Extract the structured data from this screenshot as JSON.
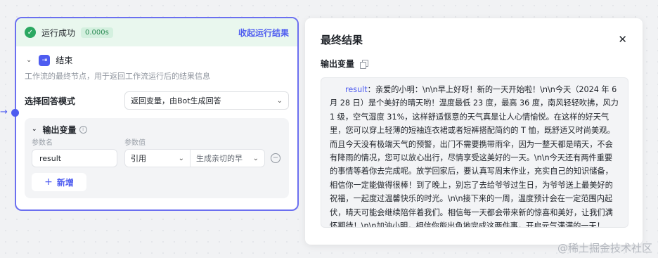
{
  "run_bar": {
    "status": "运行成功",
    "duration": "0.000s",
    "collapse_label": "收起运行结果"
  },
  "node": {
    "title": "结束",
    "description": "工作流的最终节点，用于返回工作流运行后的结果信息",
    "mode_label": "选择回答模式",
    "mode_value": "返回变量，由Bot生成回答"
  },
  "output": {
    "title": "输出变量",
    "col_name": "参数名",
    "col_value": "参数值",
    "var_name": "result",
    "ref_type": "引用",
    "ref_value": "生成亲切的早",
    "add_label": "新增"
  },
  "result_panel": {
    "title": "最终结果",
    "subtitle": "输出变量",
    "key": "result",
    "content": "：亲爱的小明：\\n\\n早上好呀！新的一天开始啦！\\n\\n今天（2024 年 6 月 28 日）是个美好的晴天哟！温度最低 23 度，最高 36 度，南风轻轻吹拂，风力 1 级，空气湿度 31%，这样舒适惬意的天气真是让人心情愉悦。在这样的好天气里，您可以穿上轻薄的短袖连衣裙或者短裤搭配简约的 T 恤，既舒适又时尚美观。而且今天没有极端天气的预警，出门不需要携带雨伞，因为一整天都是晴天，不会有降雨的情况，您可以放心出行，尽情享受这美好的一天。\\n\\n今天还有两件重要的事情等着你去完成呢。放学回家后，要认真写周末作业，充实自己的知识储备，相信你一定能做得很棒！到了晚上，别忘了去给爷爷过生日，为爷爷送上最美好的祝福，一起度过温馨快乐的时光。\\n\\n接下来的一周，温度预计会在一定范围内起伏，晴天可能会继续陪伴着我们。相信每一天都会带来新的惊喜和美好，让我们满怀期待！\\n\\n加油小明，相信你能出色地完成这两件事，开启元气满满的一天！"
  },
  "watermark": "@稀土掘金技术社区"
}
